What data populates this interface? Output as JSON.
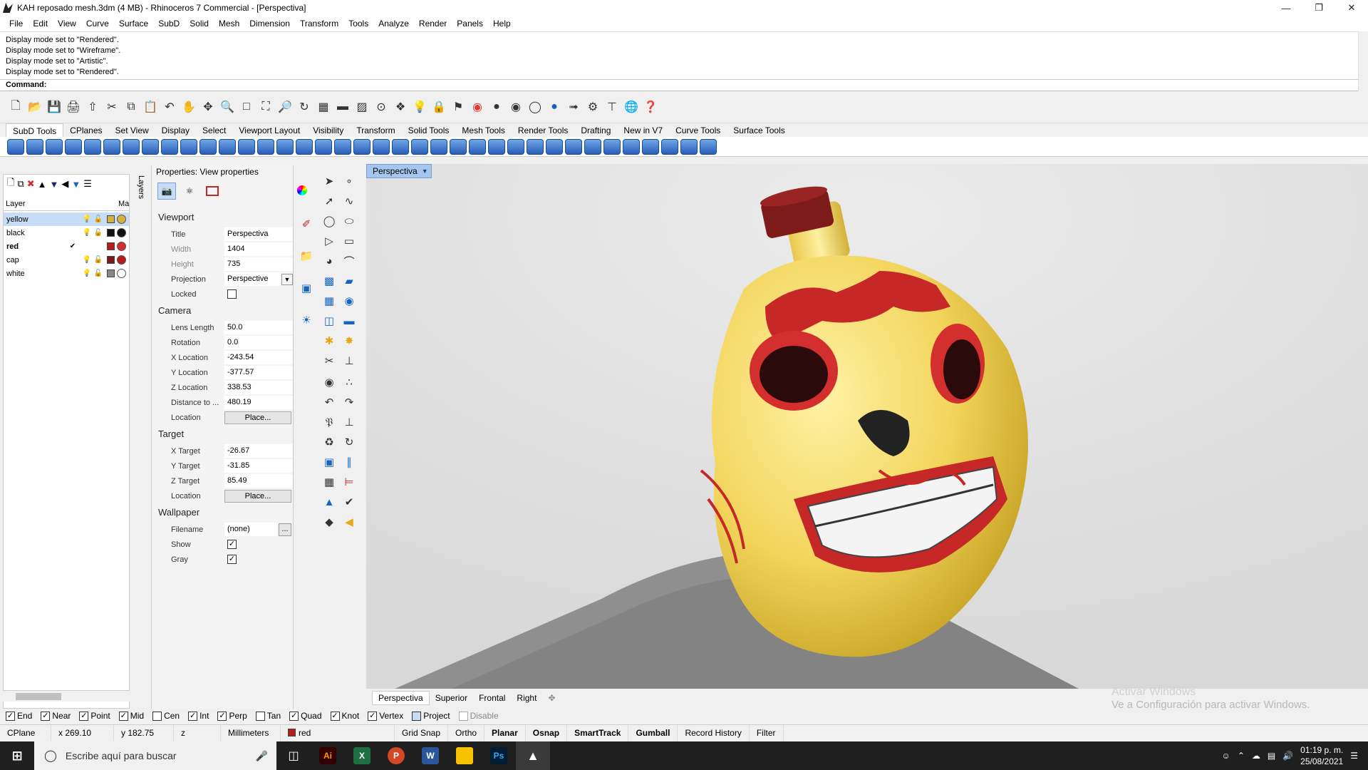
{
  "window": {
    "title": "KAH reposado mesh.3dm (4 MB) - Rhinoceros 7 Commercial - [Perspectiva]"
  },
  "menu": [
    "File",
    "Edit",
    "View",
    "Curve",
    "Surface",
    "SubD",
    "Solid",
    "Mesh",
    "Dimension",
    "Transform",
    "Tools",
    "Analyze",
    "Render",
    "Panels",
    "Help"
  ],
  "history": [
    "Display mode set to \"Rendered\".",
    "Display mode set to \"Wireframe\".",
    "Display mode set to \"Artistic\".",
    "Display mode set to \"Rendered\"."
  ],
  "command_label": "Command:",
  "toolbar_tabs": [
    "SubD Tools",
    "CPlanes",
    "Set View",
    "Display",
    "Select",
    "Viewport Layout",
    "Visibility",
    "Transform",
    "Solid Tools",
    "Mesh Tools",
    "Render Tools",
    "Drafting",
    "New in V7",
    "Curve Tools",
    "Surface Tools"
  ],
  "layers": {
    "header_layer": "Layer",
    "header_mat": "Ma",
    "side_tab": "Layers",
    "rows": [
      {
        "name": "yellow",
        "color": "#d7b13c",
        "selected": true
      },
      {
        "name": "black",
        "color": "#111111",
        "selected": false
      },
      {
        "name": "red",
        "color": "#b71c1c",
        "selected": false,
        "current": true
      },
      {
        "name": "cap",
        "color": "#7a1a1a",
        "selected": false
      },
      {
        "name": "white",
        "color": "#ffffff",
        "selected": false
      }
    ]
  },
  "properties": {
    "header": "Properties: View properties",
    "viewport_label": "Viewport",
    "title_k": "Title",
    "title_v": "Perspectiva",
    "width_k": "Width",
    "width_v": "1404",
    "height_k": "Height",
    "height_v": "735",
    "projection_k": "Projection",
    "projection_v": "Perspective",
    "locked_k": "Locked",
    "camera_label": "Camera",
    "lens_k": "Lens Length",
    "lens_v": "50.0",
    "rotation_k": "Rotation",
    "rotation_v": "0.0",
    "xloc_k": "X Location",
    "xloc_v": "-243.54",
    "yloc_k": "Y Location",
    "yloc_v": "-377.57",
    "zloc_k": "Z Location",
    "zloc_v": "338.53",
    "dist_k": "Distance to ...",
    "dist_v": "480.19",
    "location_k": "Location",
    "place_btn": "Place...",
    "target_label": "Target",
    "xt_k": "X Target",
    "xt_v": "-26.67",
    "yt_k": "Y Target",
    "yt_v": "-31.85",
    "zt_k": "Z Target",
    "zt_v": "85.49",
    "location2_k": "Location",
    "wallpaper_label": "Wallpaper",
    "filename_k": "Filename",
    "filename_v": "(none)",
    "browse": "...",
    "show_k": "Show",
    "gray_k": "Gray"
  },
  "viewport": {
    "active_tab": "Perspectiva",
    "tabs": [
      "Perspectiva",
      "Superior",
      "Frontal",
      "Right"
    ],
    "watermark_1": "Activar Windows",
    "watermark_2": "Ve a Configuración para activar Windows."
  },
  "osnaps": [
    {
      "label": "End",
      "on": true
    },
    {
      "label": "Near",
      "on": true
    },
    {
      "label": "Point",
      "on": true
    },
    {
      "label": "Mid",
      "on": true
    },
    {
      "label": "Cen",
      "on": false
    },
    {
      "label": "Int",
      "on": true
    },
    {
      "label": "Perp",
      "on": true
    },
    {
      "label": "Tan",
      "on": false
    },
    {
      "label": "Quad",
      "on": true
    },
    {
      "label": "Knot",
      "on": true
    },
    {
      "label": "Vertex",
      "on": true
    },
    {
      "label": "Project",
      "on": false
    },
    {
      "label": "Disable",
      "on": false
    }
  ],
  "status": {
    "cplane": "CPlane",
    "x": "x 269.10",
    "y": "y 182.75",
    "z": "z",
    "units": "Millimeters",
    "layer": "red",
    "toggles": [
      "Grid Snap",
      "Ortho",
      "Planar",
      "Osnap",
      "SmartTrack",
      "Gumball",
      "Record History",
      "Filter"
    ]
  },
  "taskbar": {
    "search_placeholder": "Escribe aquí para buscar",
    "time": "01:19 p. m.",
    "date": "25/08/2021"
  }
}
